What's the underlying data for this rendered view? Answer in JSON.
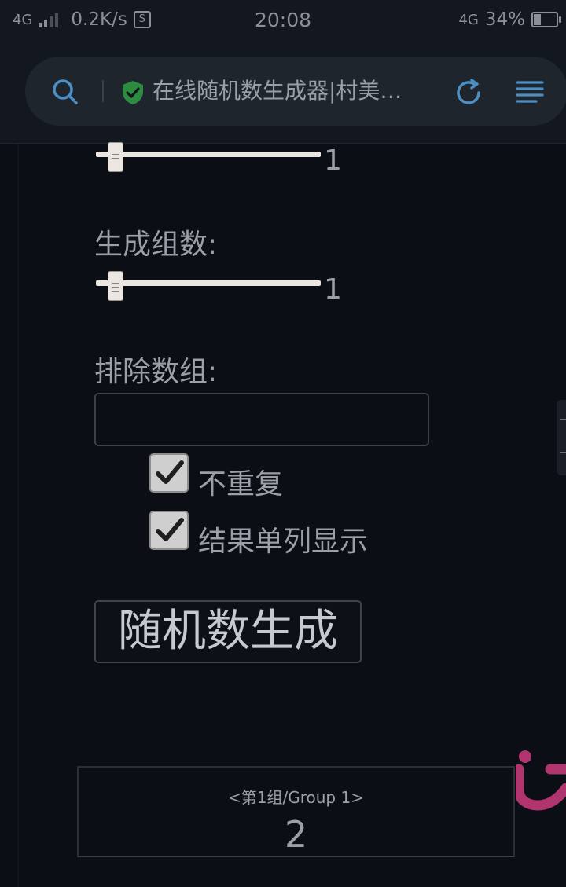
{
  "status_bar": {
    "network_left": "4G",
    "speed": "0.2K/s",
    "sim_icon_letter": "S",
    "time": "20:08",
    "network_right": "4G",
    "battery": "34%"
  },
  "browser": {
    "page_title": "在线随机数生成器|村美…",
    "icons": {
      "search": "search-icon",
      "secure": "shield-check-icon",
      "refresh": "refresh-icon",
      "menu": "menu-icon"
    },
    "colors": {
      "accent": "#4b8fc4",
      "secure": "#2c8c3f"
    }
  },
  "form": {
    "slider_top": {
      "value_label": "1",
      "value": 1
    },
    "group_count": {
      "label": "生成组数:",
      "value_label": "1",
      "value": 1
    },
    "exclude": {
      "label": "排除数组:",
      "value": "",
      "placeholder": ""
    },
    "no_repeat": {
      "label": "不重复",
      "checked": true
    },
    "single_column": {
      "label": "结果单列显示",
      "checked": true
    },
    "generate_button": "随机数生成"
  },
  "result": {
    "group_label": "<第1组/Group 1>",
    "value": "2"
  }
}
